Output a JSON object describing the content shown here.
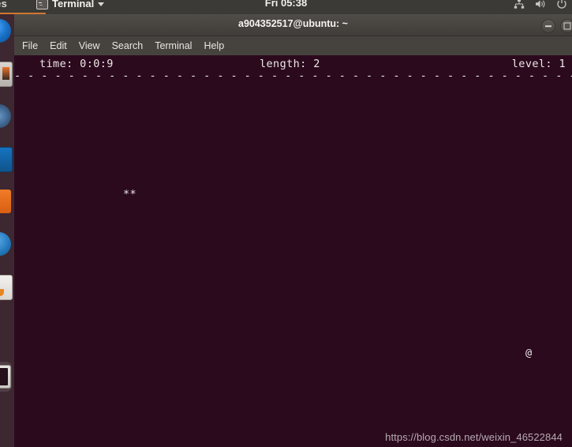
{
  "top_bar": {
    "activities_label": "ities",
    "app_name": "Terminal",
    "app_icon": "terminal-icon",
    "caret_icon": "chevron-down-icon",
    "clock": "Fri 05:38",
    "tray": [
      {
        "name": "network-icon",
        "label": "network"
      },
      {
        "name": "volume-icon",
        "label": "volume"
      },
      {
        "name": "power-icon",
        "label": "power"
      }
    ]
  },
  "dock": {
    "items": [
      {
        "name": "dock-item-firefox",
        "label": "Firefox",
        "icon": "firefox-icon",
        "active": false
      },
      {
        "name": "dock-item-files",
        "label": "Files",
        "icon": "files-icon",
        "active": false
      },
      {
        "name": "dock-item-rhythmbox",
        "label": "Rhythmbox",
        "icon": "rhythmbox-icon",
        "active": false
      },
      {
        "name": "dock-item-libreoffice-writer",
        "label": "LibreOffice Writer",
        "icon": "libreoffice-writer-icon",
        "active": false
      },
      {
        "name": "dock-item-software",
        "label": "Ubuntu Software",
        "icon": "software-icon",
        "active": false
      },
      {
        "name": "dock-item-help",
        "label": "Help",
        "icon": "help-icon",
        "active": false
      },
      {
        "name": "dock-item-amazon",
        "label": "Amazon",
        "icon": "amazon-icon",
        "active": false
      },
      {
        "name": "dock-item-terminal",
        "label": "Terminal",
        "icon": "terminal-icon",
        "active": true
      }
    ]
  },
  "window": {
    "title": "a904352517@ubuntu: ~",
    "buttons": {
      "minimize": "minimize-button",
      "maximize": "maximize-button"
    },
    "menu": [
      {
        "label": "File"
      },
      {
        "label": "Edit"
      },
      {
        "label": "View"
      },
      {
        "label": "Search"
      },
      {
        "label": "Terminal"
      },
      {
        "label": "Help"
      }
    ]
  },
  "game": {
    "status": {
      "time": "time: 0:0:9",
      "length": "length: 2",
      "level": "level: 1"
    },
    "border": "- - - - - - - - - - - - - - - - - - - - - - - - - - - - - - - - - - - - - - - - - - - - - - - - - - - - - - - - - - - -",
    "snake_body": "**",
    "food": "@"
  },
  "watermark": "https://blog.csdn.net/weixin_46522844",
  "colors": {
    "terminal_bg": "#2c0a1e",
    "terminal_fg": "#e6e2de",
    "titlebar_bg": "#403d39",
    "topbar_bg": "#3b3a36",
    "dock_bg": "#3d2730",
    "accent_orange": "#d0762f"
  }
}
